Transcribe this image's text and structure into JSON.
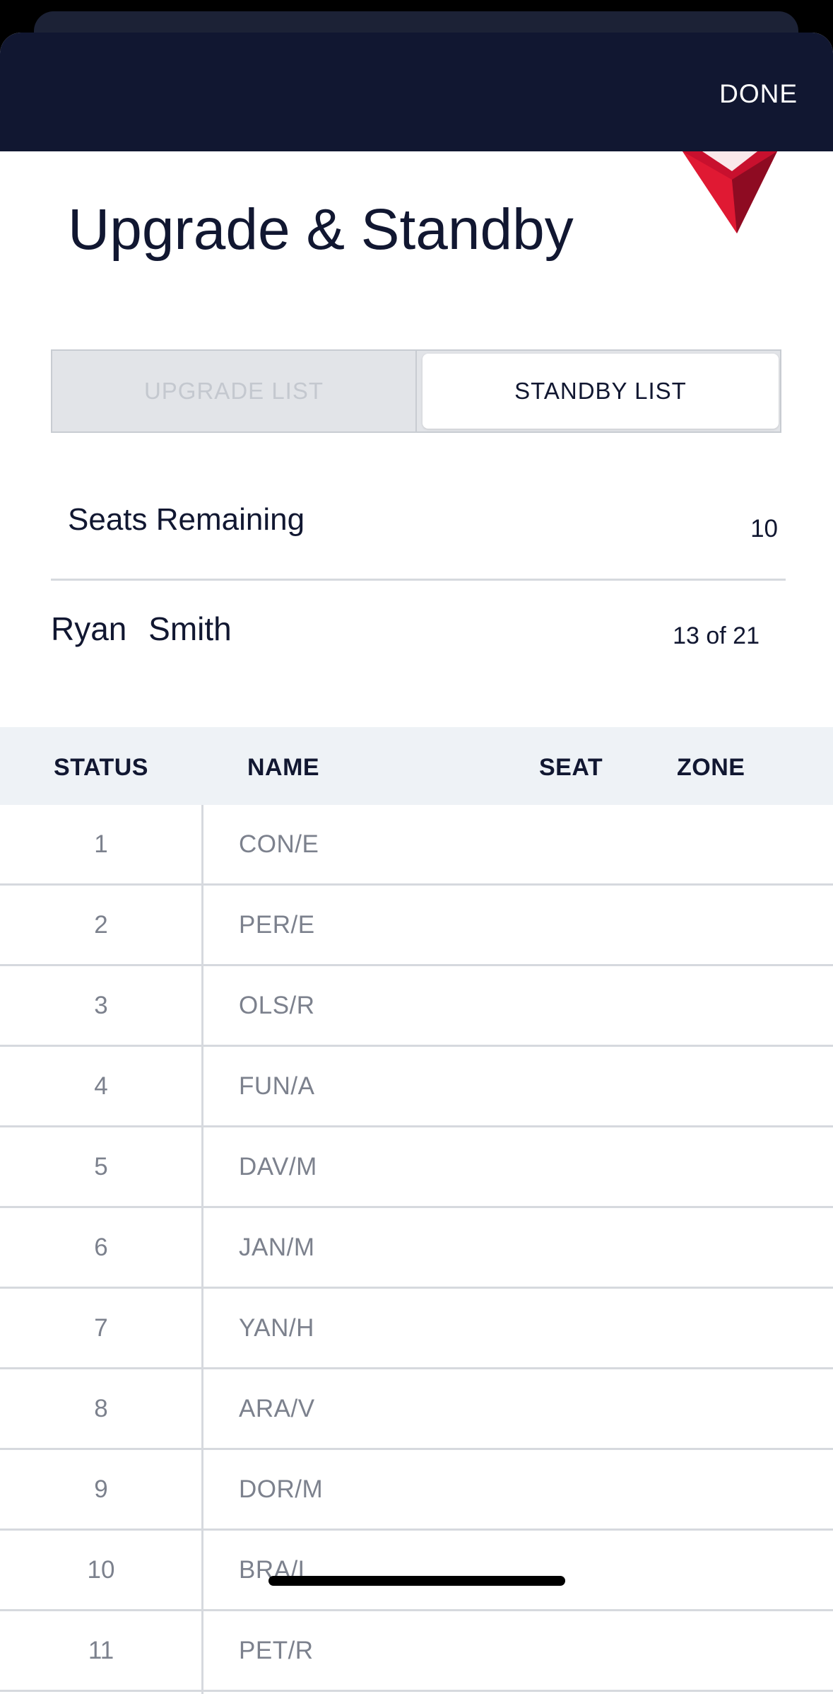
{
  "header": {
    "done_label": "DONE"
  },
  "page": {
    "title": "Upgrade & Standby"
  },
  "tabs": {
    "upgrade_label": "UPGRADE LIST",
    "standby_label": "STANDBY LIST",
    "selected": "STANDBY LIST"
  },
  "seats": {
    "label": "Seats Remaining",
    "value": "10"
  },
  "passenger": {
    "name": "Ryan Smith",
    "position": "13 of 21"
  },
  "table": {
    "headers": {
      "status": "STATUS",
      "name": "NAME",
      "seat": "SEAT",
      "zone": "ZONE"
    },
    "rows": [
      {
        "status": "1",
        "name": "CON/E"
      },
      {
        "status": "2",
        "name": "PER/E"
      },
      {
        "status": "3",
        "name": "OLS/R"
      },
      {
        "status": "4",
        "name": "FUN/A"
      },
      {
        "status": "5",
        "name": "DAV/M"
      },
      {
        "status": "6",
        "name": "JAN/M"
      },
      {
        "status": "7",
        "name": "YAN/H"
      },
      {
        "status": "8",
        "name": "ARA/V"
      },
      {
        "status": "9",
        "name": "DOR/M"
      },
      {
        "status": "10",
        "name": "BRA/L"
      },
      {
        "status": "11",
        "name": "PET/R"
      }
    ]
  },
  "colors": {
    "header_bg": "#111731",
    "logo_red": "#c8102e"
  }
}
